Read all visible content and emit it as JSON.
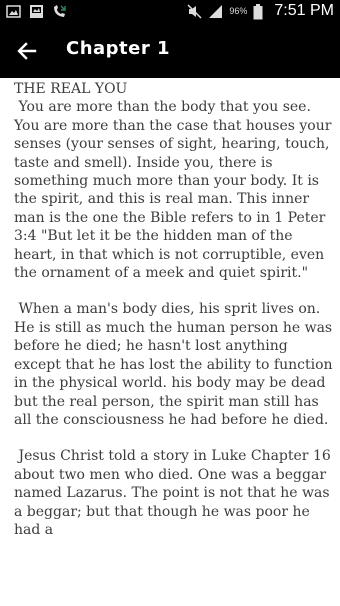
{
  "status_bar": {
    "time": "7:51 PM",
    "battery_percent": "96%",
    "icons": [
      "image-icon",
      "gallery-icon",
      "phone-missed-icon",
      "mute-icon",
      "signal-icon",
      "battery-icon"
    ]
  },
  "app_bar": {
    "title": "Chapter 1",
    "back_icon": "arrow-back-icon"
  },
  "chapter": {
    "heading": "THE REAL YOU",
    "paragraphs": [
      " You are more than the body that you see. You are more than the case that houses your senses (your senses of sight, hearing, touch, taste and smell). Inside you, there is something much more than your body. It is the spirit, and this is real man. This inner man is the one the Bible refers to in 1 Peter 3:4 \"But let it be the hidden man of the heart, in that which is not corruptible, even the ornament of a meek and quiet spirit.\"",
      " When a man's body dies, his sprit lives on. He is still as much the human person he was before he died; he hasn't lost anything except that he has lost the ability to function in the physical world. his body may be dead but the real person, the spirit man still has all the consciousness he had before he died.",
      " Jesus Christ told a story in Luke Chapter 16 about two men who died. One was a beggar named Lazarus. The point is not that he was a beggar; but that though he was poor he had a"
    ]
  }
}
